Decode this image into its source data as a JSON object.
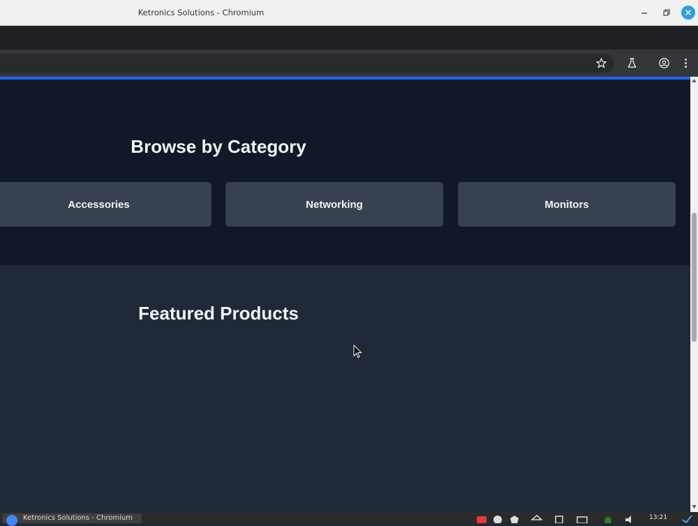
{
  "window": {
    "title": "Ketronics Solutions - Chromium"
  },
  "categories": {
    "title": "Browse by Category",
    "items": [
      {
        "label": "Accessories"
      },
      {
        "label": "Networking"
      },
      {
        "label": "Monitors"
      }
    ]
  },
  "featured": {
    "title": "Featured Products"
  },
  "taskbar": {
    "task_label": "Ketronics Solutions - Chromium",
    "clock": "13:21"
  },
  "colors": {
    "accent": "#2563eb",
    "category_bg": "#111827",
    "page_bg": "#1f2937",
    "card_bg": "#374151",
    "heading_text": "#f3f4f6"
  }
}
